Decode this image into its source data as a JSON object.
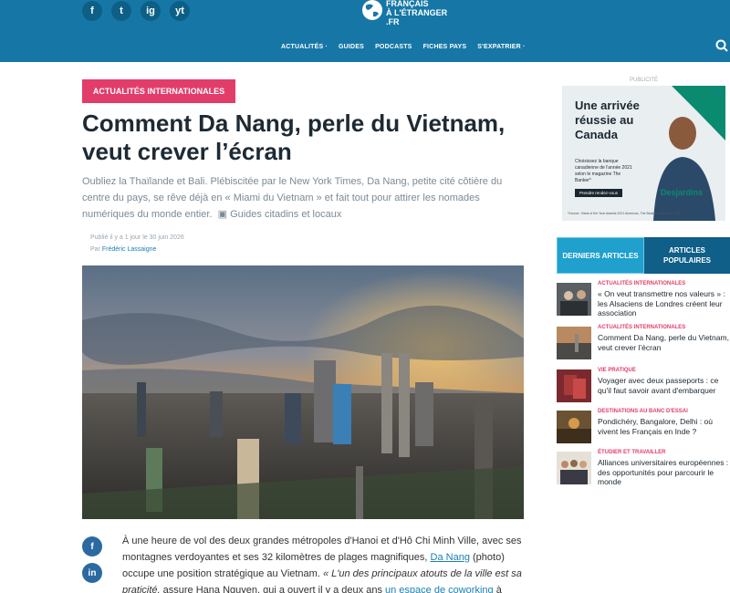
{
  "header": {
    "social": [
      "f",
      "t",
      "ig",
      "yt"
    ],
    "logo_lines": [
      "FRANÇAIS",
      "À L'ÉTRANGER",
      ".FR"
    ],
    "nav": [
      "ACTUALITÉS ·",
      "GUIDES",
      "PODCASTS",
      "FICHES PAYS",
      "S'EXPATRIER ·"
    ],
    "icons": [
      "facebook-icon",
      "twitter-icon",
      "instagram-icon",
      "youtube-icon",
      "search-icon"
    ]
  },
  "article": {
    "category": "ACTUALITÉS INTERNATIONALES",
    "title": "Comment Da Nang, perle du Vietnam, veut crever l’écran",
    "lede": "Oubliez la Thaïlande et Bali. Plébiscitée par le New York Times, Da Nang, petite cité côtière du centre du pays, se rêve déjà en « Miami du Vietnam » et fait tout pour attirer les nomades numériques du monde entier.",
    "lede_tag": "Guides citadins et locaux",
    "published": "Publié il y a 1 jour le 30 juin 2026",
    "by": "Par",
    "author": "Frédéric Lassaigne",
    "body_1": "À une heure de vol des deux grandes métropoles d'Hanoi et d'Hô Chi Minh Ville, avec ses montagnes verdoyantes et ses 32 kilomètres de plages magnifiques,",
    "body_link1": "Da Nang",
    "body_2": "(photo) occupe une position stratégique au Vietnam.",
    "body_quote": "« L'un des principaux atouts de la ville est sa praticité,",
    "body_3": "assure Hana Nguyen, qui a ouvert il y a deux ans",
    "body_link2": "un espace de coworking",
    "body_4": "à"
  },
  "share": [
    "f",
    "in"
  ],
  "sidebar": {
    "pub": "PUBLICITÉ",
    "ad": {
      "headline": "Une arrivée réussie au Canada",
      "copy": "Choisissez la banque canadienne de l'année 2021 selon le magazine The Banker*",
      "button": "Prendre rendez-vous",
      "brand": "Desjardins",
      "fine": "*Source : Bank of the Year Awards 2021 Americas, The Banker, décembre 2021",
      "close": "i ✕"
    },
    "tabs": [
      "DERNIERS ARTICLES",
      "ARTICLES POPULAIRES"
    ],
    "items": [
      {
        "cat": "ACTUALITÉS INTERNATIONALES",
        "title": "« On veut transmettre nos valeurs » : les Alsaciens de Londres créent leur association"
      },
      {
        "cat": "ACTUALITÉS INTERNATIONALES",
        "title": "Comment Da Nang, perle du Vietnam, veut crever l’écran"
      },
      {
        "cat": "VIE PRATIQUE",
        "title": "Voyager avec deux passeports : ce qu'il faut savoir avant d'embarquer"
      },
      {
        "cat": "DESTINATIONS AU BANC D'ESSAI",
        "title": "Pondichéry, Bangalore, Delhi : où vivent les Français en Inde ?"
      },
      {
        "cat": "ÉTUDIER ET TRAVAILLER",
        "title": "Alliances universitaires européennes : des opportunités pour parcourir le monde"
      }
    ]
  },
  "colors": {
    "header": "#1677a6",
    "accent": "#e23d6a",
    "tab_active": "#1fa0cd",
    "tab_other": "#0f5f88",
    "link": "#1a7fb3"
  }
}
